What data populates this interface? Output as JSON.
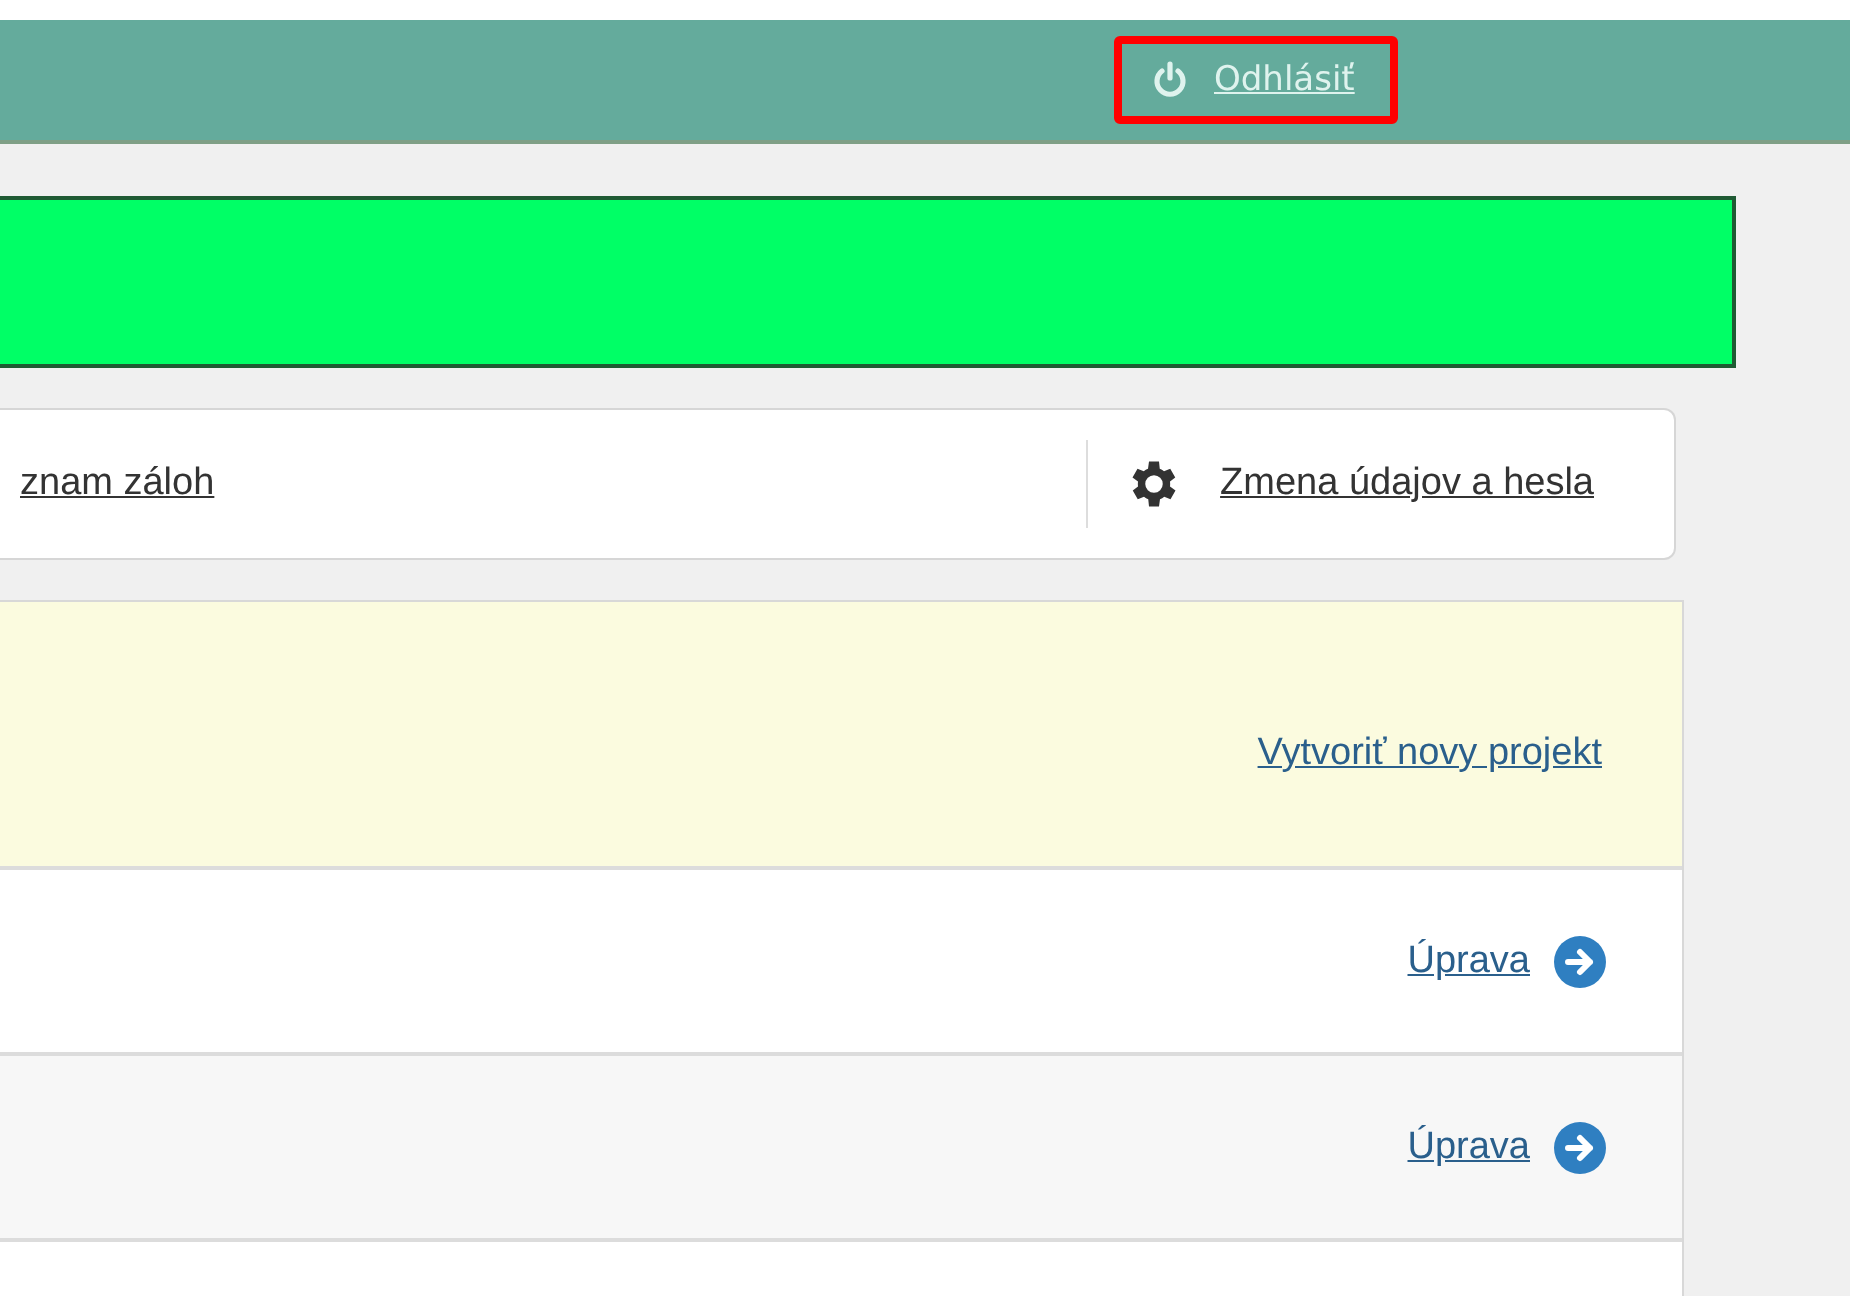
{
  "header": {
    "logout": {
      "label": "Odhlásiť",
      "highlighted": true
    }
  },
  "nav": {
    "items": [
      {
        "label": "znam záloh",
        "kind": "plain"
      },
      {
        "label": "Zmena údajov a hesla",
        "kind": "settings"
      }
    ]
  },
  "projects": {
    "create_link": "Vytvoriť novy projekt",
    "rows": [
      {
        "action": "Úprava"
      },
      {
        "action": "Úprava"
      }
    ]
  }
}
